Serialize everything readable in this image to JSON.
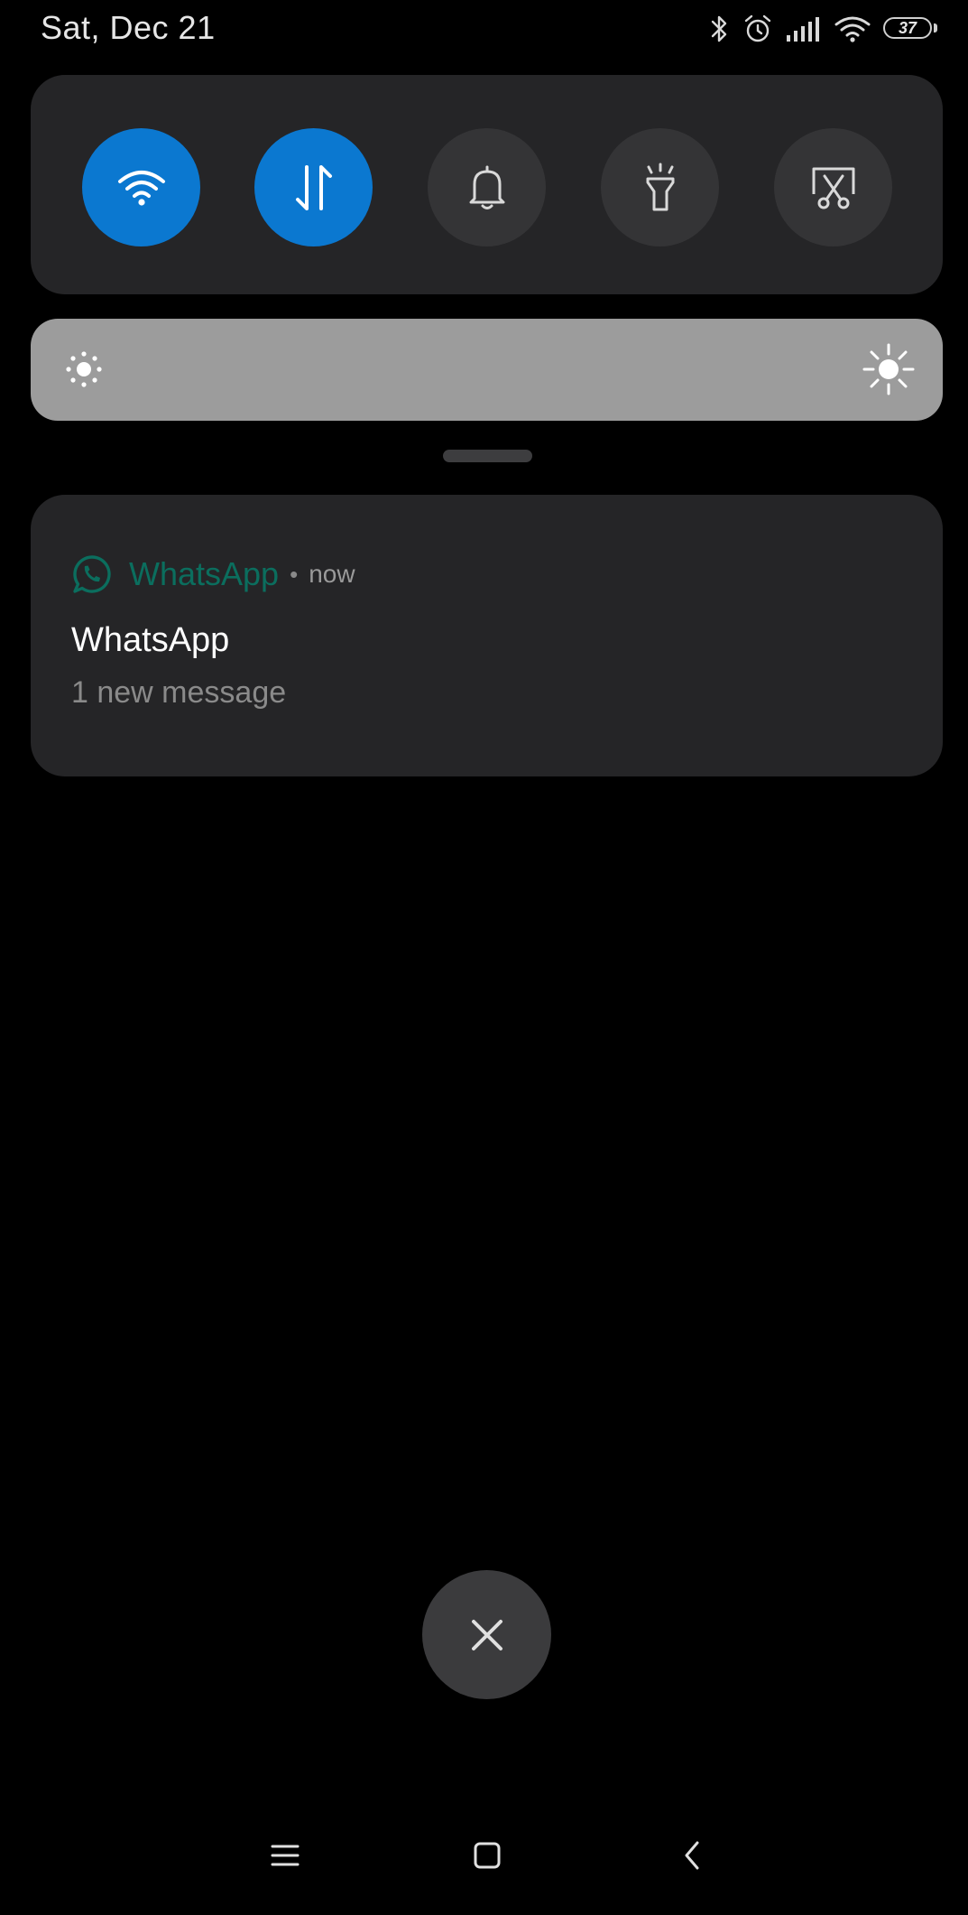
{
  "status_bar": {
    "date": "Sat, Dec 21",
    "battery_level": "37",
    "icons": [
      "bluetooth-icon",
      "alarm-icon",
      "signal-icon",
      "wifi-icon",
      "battery-icon"
    ]
  },
  "quick_settings": {
    "tiles": [
      {
        "name": "wifi",
        "icon": "wifi-icon",
        "active": true
      },
      {
        "name": "mobile-data",
        "icon": "data-transfer-icon",
        "active": true
      },
      {
        "name": "sound",
        "icon": "bell-icon",
        "active": false
      },
      {
        "name": "flashlight",
        "icon": "flashlight-icon",
        "active": false
      },
      {
        "name": "screenshot",
        "icon": "screenshot-icon",
        "active": false
      }
    ],
    "active_color": "#0b78d0",
    "inactive_color": "#343436"
  },
  "brightness": {
    "low_icon": "brightness-low-icon",
    "high_icon": "brightness-high-icon"
  },
  "notification": {
    "app_name": "WhatsApp",
    "separator": "•",
    "time": "now",
    "title": "WhatsApp",
    "body": "1 new message",
    "app_color": "#0b6e5e"
  },
  "clear_all": {
    "icon": "close-icon"
  },
  "nav_bar": {
    "icons": [
      "menu-icon",
      "home-icon",
      "back-icon"
    ]
  }
}
